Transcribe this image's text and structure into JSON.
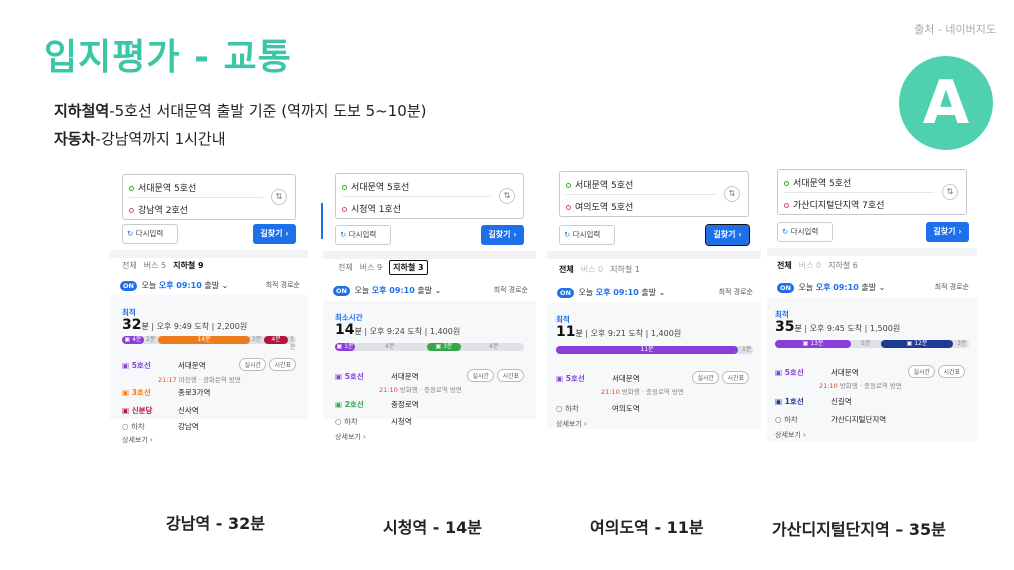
{
  "title": "입지평가 - 교통",
  "source": "출처 - 네이버지도",
  "badge": "A",
  "desc1": {
    "bold": "지하철역",
    "text": "-5호선 서대문역 출발 기준 (역까지 도보 5~10분)"
  },
  "desc2": {
    "bold": "자동차",
    "text": "-강남역까지 1시간내"
  },
  "common": {
    "redo": "다시입력",
    "find": "길찾기",
    "on": "ON",
    "today": "오늘",
    "time": "오후 09:10",
    "depart": "출발",
    "sort": "최적 경로순",
    "more": "상세보기",
    "exit": "하차",
    "realtime": "실시간",
    "timetable": "시간표"
  },
  "panels": [
    {
      "from": "서대문역 5호선",
      "to": "강남역 2호선",
      "tab_all": "전체",
      "tab_bus": "버스 5",
      "tab_sub": "지하철 9",
      "best": "최적",
      "minutes": "32",
      "unit": "분",
      "arrive": "오후 9:49 도착",
      "fare": "2,200원",
      "s1_line": "5호선",
      "s1_name": "서대문역",
      "s1_sub_time": "21:17",
      "s1_sub_dir": "마천행 · 광화문역 방면",
      "s2_line": "3호선",
      "s2_name": "종로3가역",
      "s3_line": "신분당",
      "s3_name": "신사역",
      "exit_name": "강남역",
      "segs": [
        "4분",
        "14분",
        "4분"
      ],
      "gaps": [
        "2분",
        "2분"
      ],
      "walk": "3분",
      "caption": "강남역 - 32분"
    },
    {
      "from": "서대문역 5호선",
      "to": "시청역 1호선",
      "tab_all": "전체",
      "tab_bus": "버스 9",
      "tab_sub": "지하철 3",
      "best": "최소시간",
      "minutes": "14",
      "unit": "분",
      "arrive": "오후 9:24 도착",
      "fare": "1,400원",
      "s1_line": "5호선",
      "s1_name": "서대문역",
      "s1_sub_time": "21:10",
      "s1_sub_dir": "방화행 · 충정로역 방면",
      "s2_line": "2호선",
      "s2_name": "충정로역",
      "exit_name": "시청역",
      "segs": [
        "1분",
        "3분"
      ],
      "gaps": [
        "4분",
        "4분"
      ],
      "caption": "시청역 - 14분"
    },
    {
      "from": "서대문역 5호선",
      "to": "여의도역 5호선",
      "tab_all": "전체",
      "tab_bus": "버스 0",
      "tab_sub": "지하철 1",
      "best": "최적",
      "minutes": "11",
      "unit": "분",
      "arrive": "오후 9:21 도착",
      "fare": "1,400원",
      "s1_line": "5호선",
      "s1_name": "서대문역",
      "s1_sub_time": "21:10",
      "s1_sub_dir": "방화행 · 충정로역 방면",
      "exit_name": "여의도역",
      "segs": [
        "11분"
      ],
      "walk": "1분",
      "caption": "여의도역 - 11분"
    },
    {
      "from": "서대문역 5호선",
      "to": "가산디지털단지역 7호선",
      "tab_all": "전체",
      "tab_bus": "버스 0",
      "tab_sub": "지하철 6",
      "best": "최적",
      "minutes": "35",
      "unit": "분",
      "arrive": "오후 9:45 도착",
      "fare": "1,500원",
      "s1_line": "5호선",
      "s1_name": "서대문역",
      "s1_sub_time": "21:10",
      "s1_sub_dir": "방화행 · 충정로역 방면",
      "s2_line": "1호선",
      "s2_name": "신길역",
      "exit_name": "가산디지털단지역",
      "segs": [
        "13분",
        "12분"
      ],
      "gaps": [
        "5분"
      ],
      "walk": "3분",
      "caption": "가산디지털단지역 – 35분"
    }
  ],
  "colors": {
    "line5": "#8b3fd9",
    "line2": "#37a64a",
    "line3": "#ef7c1c",
    "lineSB": "#b5123f",
    "line1": "#1f3a93",
    "accent": "#3cc6a6",
    "blue": "#1e6fea"
  }
}
